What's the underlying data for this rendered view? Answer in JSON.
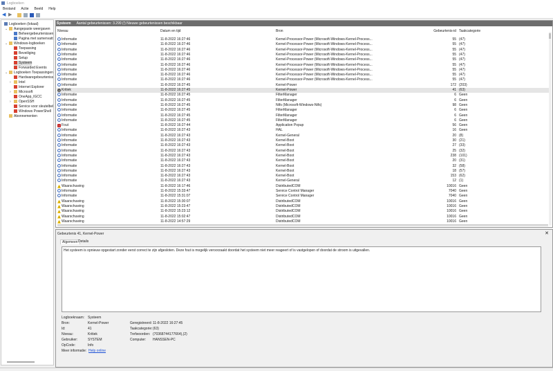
{
  "window": {
    "title": "Logboeken"
  },
  "menu": [
    "Bestand",
    "Actie",
    "Beeld",
    "Help"
  ],
  "toolbar": {
    "icons": [
      "back-arrow-icon",
      "forward-arrow-icon",
      "open-folder-icon",
      "console-tree-icon",
      "help-icon",
      "properties-icon"
    ]
  },
  "tree": [
    {
      "label": "Logboeken (lokaal)",
      "level": 0,
      "icon": "event-viewer-icon"
    },
    {
      "label": "Aangepaste weergaven",
      "level": 1,
      "icon": "folder-icon",
      "expanded": true
    },
    {
      "label": "Beheergebeurtenissen",
      "level": 2,
      "icon": "filter-icon"
    },
    {
      "label": "Pagina met samenvatting",
      "level": 2,
      "icon": "filter-icon"
    },
    {
      "label": "Windows-logboeken",
      "level": 1,
      "icon": "folder-icon",
      "expanded": true
    },
    {
      "label": "Toepassing",
      "level": 2,
      "icon": "log-icon"
    },
    {
      "label": "Beveiliging",
      "level": 2,
      "icon": "log-icon"
    },
    {
      "label": "Setup",
      "level": 2,
      "icon": "log-icon"
    },
    {
      "label": "Systeem",
      "level": 2,
      "icon": "log-icon",
      "selected": true
    },
    {
      "label": "Forwarded Events",
      "level": 2,
      "icon": "log-icon"
    },
    {
      "label": "Logboeken Toepassingen en services",
      "level": 1,
      "icon": "folder-icon",
      "expanded": true
    },
    {
      "label": "Hardwaregebeurtenissen",
      "level": 2,
      "icon": "log-icon"
    },
    {
      "label": "Intel",
      "level": 2,
      "icon": "folder-icon",
      "collapsed": true
    },
    {
      "label": "Internet Explorer",
      "level": 2,
      "icon": "log-icon"
    },
    {
      "label": "Microsoft",
      "level": 2,
      "icon": "folder-icon",
      "collapsed": true
    },
    {
      "label": "OneApp_IGCC",
      "level": 2,
      "icon": "log-icon"
    },
    {
      "label": "OpenSSH",
      "level": 2,
      "icon": "folder-icon",
      "collapsed": true
    },
    {
      "label": "Service voor sleutelbeheer",
      "level": 2,
      "icon": "log-icon"
    },
    {
      "label": "Windows PowerShell",
      "level": 2,
      "icon": "log-icon"
    },
    {
      "label": "Abonnementen",
      "level": 1,
      "icon": "subscriptions-icon"
    }
  ],
  "main": {
    "log_name": "Systeem",
    "summary": "Aantal gebeurtenissen: 3.299 (!) Nieuwe gebeurtenissen beschikbaar",
    "columns": [
      "Niveau",
      "Datum en tijd",
      "Bron",
      "Gebeurtenis-id",
      "Taakcategorie"
    ],
    "rows": [
      [
        "Informatie",
        "11-8-2022 16:27:46",
        "Kernel-Processor-Power (Microsoft-Windows-Kernel-Process...",
        "55",
        "(47)"
      ],
      [
        "Informatie",
        "11-8-2022 16:27:46",
        "Kernel-Processor-Power (Microsoft-Windows-Kernel-Process...",
        "55",
        "(47)"
      ],
      [
        "Informatie",
        "11-8-2022 16:27:46",
        "Kernel-Processor-Power (Microsoft-Windows-Kernel-Process...",
        "55",
        "(47)"
      ],
      [
        "Informatie",
        "11-8-2022 16:27:46",
        "Kernel-Processor-Power (Microsoft-Windows-Kernel-Process...",
        "55",
        "(47)"
      ],
      [
        "Informatie",
        "11-8-2022 16:27:46",
        "Kernel-Processor-Power (Microsoft-Windows-Kernel-Process...",
        "55",
        "(47)"
      ],
      [
        "Informatie",
        "11-8-2022 16:27:46",
        "Kernel-Processor-Power (Microsoft-Windows-Kernel-Process...",
        "55",
        "(47)"
      ],
      [
        "Informatie",
        "11-8-2022 16:27:46",
        "Kernel-Processor-Power (Microsoft-Windows-Kernel-Process...",
        "55",
        "(47)"
      ],
      [
        "Informatie",
        "11-8-2022 16:27:46",
        "Kernel-Processor-Power (Microsoft-Windows-Kernel-Process...",
        "55",
        "(47)"
      ],
      [
        "Informatie",
        "11-8-2022 16:27:46",
        "Kernel-Processor-Power (Microsoft-Windows-Kernel-Process...",
        "55",
        "(47)"
      ],
      [
        "Informatie",
        "11-8-2022 16:27:45",
        "Kernel-Power",
        "172",
        "(203)"
      ],
      [
        "Kritiek",
        "11-8-2022 16:27:45",
        "Kernel-Power",
        "41",
        "(63)"
      ],
      [
        "Informatie",
        "11-8-2022 16:27:45",
        "FilterManager",
        "6",
        "Geen"
      ],
      [
        "Informatie",
        "11-8-2022 16:27:45",
        "FilterManager",
        "6",
        "Geen"
      ],
      [
        "Informatie",
        "11-8-2022 16:27:45",
        "Ntfs (Microsoft-Windows-Ntfs)",
        "98",
        "Geen"
      ],
      [
        "Informatie",
        "11-8-2022 16:27:45",
        "FilterManager",
        "6",
        "Geen"
      ],
      [
        "Informatie",
        "11-8-2022 16:27:45",
        "FilterManager",
        "6",
        "Geen"
      ],
      [
        "Informatie",
        "11-8-2022 16:27:45",
        "FilterManager",
        "6",
        "Geen"
      ],
      [
        "Fout",
        "11-8-2022 16:27:44",
        "Application Popup",
        "56",
        "Geen"
      ],
      [
        "Informatie",
        "11-8-2022 16:27:43",
        "HAL",
        "16",
        "Geen"
      ],
      [
        "Informatie",
        "11-8-2022 16:27:43",
        "Kernel-General",
        "20",
        "(8)"
      ],
      [
        "Informatie",
        "11-8-2022 16:27:43",
        "Kernel-Boot",
        "30",
        "(21)"
      ],
      [
        "Informatie",
        "11-8-2022 16:27:43",
        "Kernel-Boot",
        "27",
        "(33)"
      ],
      [
        "Informatie",
        "11-8-2022 16:27:43",
        "Kernel-Boot",
        "25",
        "(32)"
      ],
      [
        "Informatie",
        "11-8-2022 16:27:43",
        "Kernel-Boot",
        "238",
        "(101)"
      ],
      [
        "Informatie",
        "11-8-2022 16:27:43",
        "Kernel-Boot",
        "20",
        "(31)"
      ],
      [
        "Informatie",
        "11-8-2022 16:27:43",
        "Kernel-Boot",
        "32",
        "(58)"
      ],
      [
        "Informatie",
        "11-8-2022 16:27:43",
        "Kernel-Boot",
        "18",
        "(57)"
      ],
      [
        "Informatie",
        "11-8-2022 16:27:43",
        "Kernel-Boot",
        "153",
        "(62)"
      ],
      [
        "Informatie",
        "11-8-2022 16:27:43",
        "Kernel-General",
        "12",
        "(1)"
      ],
      [
        "Waarschuwing",
        "11-8-2022 16:17:46",
        "DistributedCOM",
        "10016",
        "Geen"
      ],
      [
        "Informatie",
        "11-8-2022 15:33:47",
        "Service Control Manager",
        "7040",
        "Geen"
      ],
      [
        "Informatie",
        "11-8-2022 15:31:07",
        "Service Control Manager",
        "7040",
        "Geen"
      ],
      [
        "Waarschuwing",
        "11-8-2022 15:30:07",
        "DistributedCOM",
        "10016",
        "Geen"
      ],
      [
        "Waarschuwing",
        "11-8-2022 15:23:47",
        "DistributedCOM",
        "10016",
        "Geen"
      ],
      [
        "Waarschuwing",
        "11-8-2022 15:23:12",
        "DistributedCOM",
        "10016",
        "Geen"
      ],
      [
        "Waarschuwing",
        "11-8-2022 15:02:47",
        "DistributedCOM",
        "10016",
        "Geen"
      ],
      [
        "Waarschuwing",
        "11-8-2022 14:57:29",
        "DistributedCOM",
        "10016",
        "Geen"
      ]
    ],
    "selected_row": 10
  },
  "detail": {
    "title": "Gebeurtenis 41, Kernel-Power",
    "close": "✕",
    "tabs": [
      "Algemeen",
      "Details"
    ],
    "message": "Het systeem is opnieuw opgestart zonder eerst correct te zijn afgesloten. Deze fout is mogelijk veroorzaakt doordat het systeem niet meer reageert of is vastgelopen of doordat de stroom is uitgevallen.",
    "props": {
      "log_label": "Logboeknaam:",
      "log": "Systeem",
      "source_label": "Bron:",
      "source": "Kernel-Power",
      "logged_label": "Geregistreerd:",
      "logged": "11-8-2022 16:27:45",
      "id_label": "Id:",
      "id": "41",
      "task_label": "Taakcategorie:",
      "task": "(63)",
      "level_label": "Niveau:",
      "level": "Kritiek",
      "keywords_label": "Trefwoorden:",
      "keywords": "(70368744177664),(2)",
      "user_label": "Gebruiker:",
      "user": "SYSTEM",
      "computer_label": "Computer:",
      "computer": "HANSSEN-PC",
      "opcode_label": "OpCode:",
      "opcode": "Info",
      "more_label": "Meer informatie:",
      "more_link": "Help online"
    }
  },
  "colors": {
    "header_bar": "#6d6d6d",
    "selected_row": "#e5e5e5",
    "link": "#1a4fd6"
  }
}
